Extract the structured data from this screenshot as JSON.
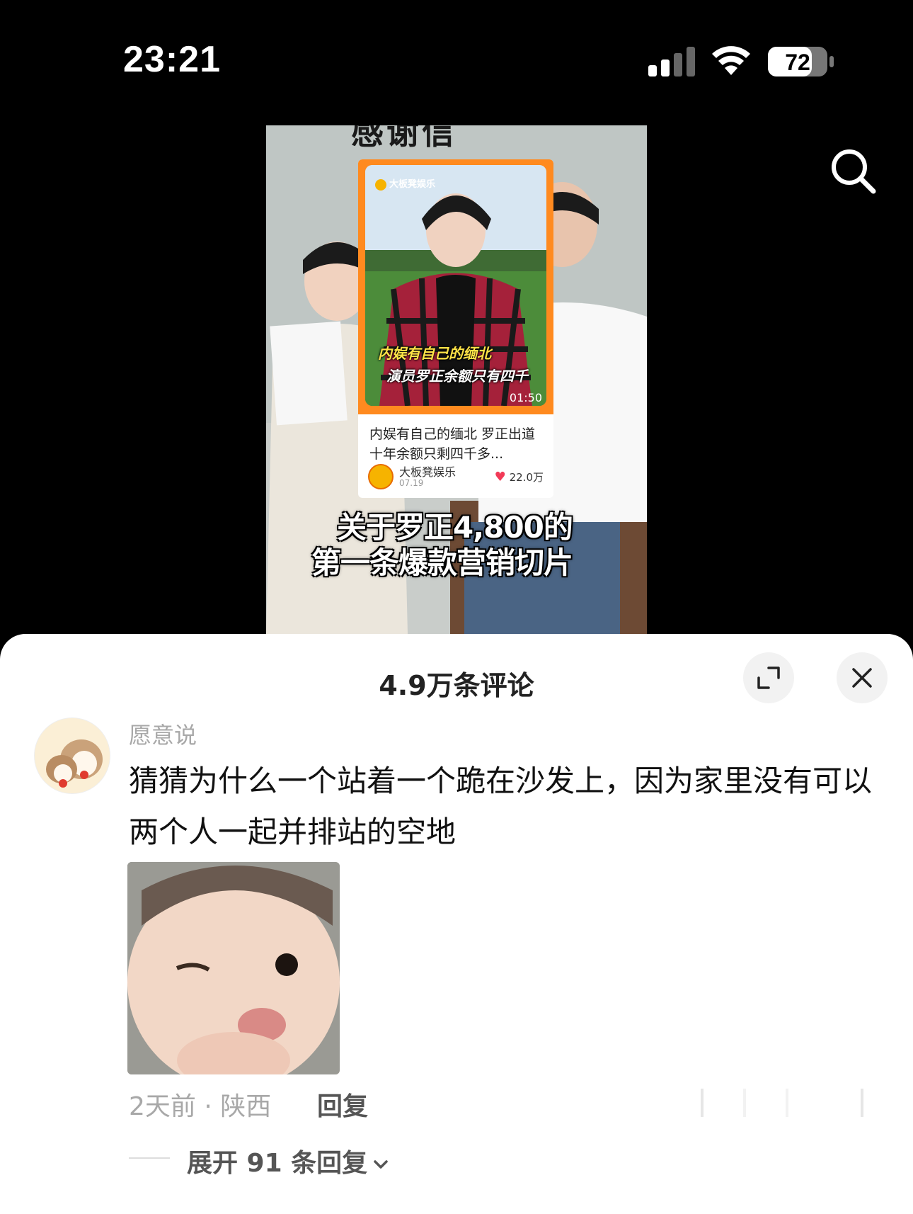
{
  "status_bar": {
    "time": "23:21",
    "battery": "72"
  },
  "video": {
    "top_overlay_text": "感谢信",
    "card": {
      "brand": "大板凳娱乐",
      "caption_line1": "内娱有自己的缅北",
      "caption_line2": "演员罗正余额只有四千",
      "duration": "01:50",
      "title": "内娱有自己的缅北 罗正出道十年余额只剩四千多...",
      "author": "大板凳娱乐",
      "date": "07.19",
      "likes": "22.0万"
    },
    "overlay_caption_line1": "关于罗正4,800的",
    "overlay_caption_line2": "第一条爆款营销切片"
  },
  "comments_sheet": {
    "title": "4.9万条评论",
    "comment": {
      "username": "愿意说",
      "text": "猜猜为什么一个站着一个跪在沙发上，因为家里没有可以两个人一起并排站的空地",
      "time_location": "2天前 · 陕西",
      "reply_label": "回复",
      "expand_replies": "展开 91 条回复"
    }
  },
  "icons": {
    "search": "search-icon",
    "expand": "expand-icon",
    "close": "close-icon",
    "chevron": "chevron-down-icon"
  }
}
